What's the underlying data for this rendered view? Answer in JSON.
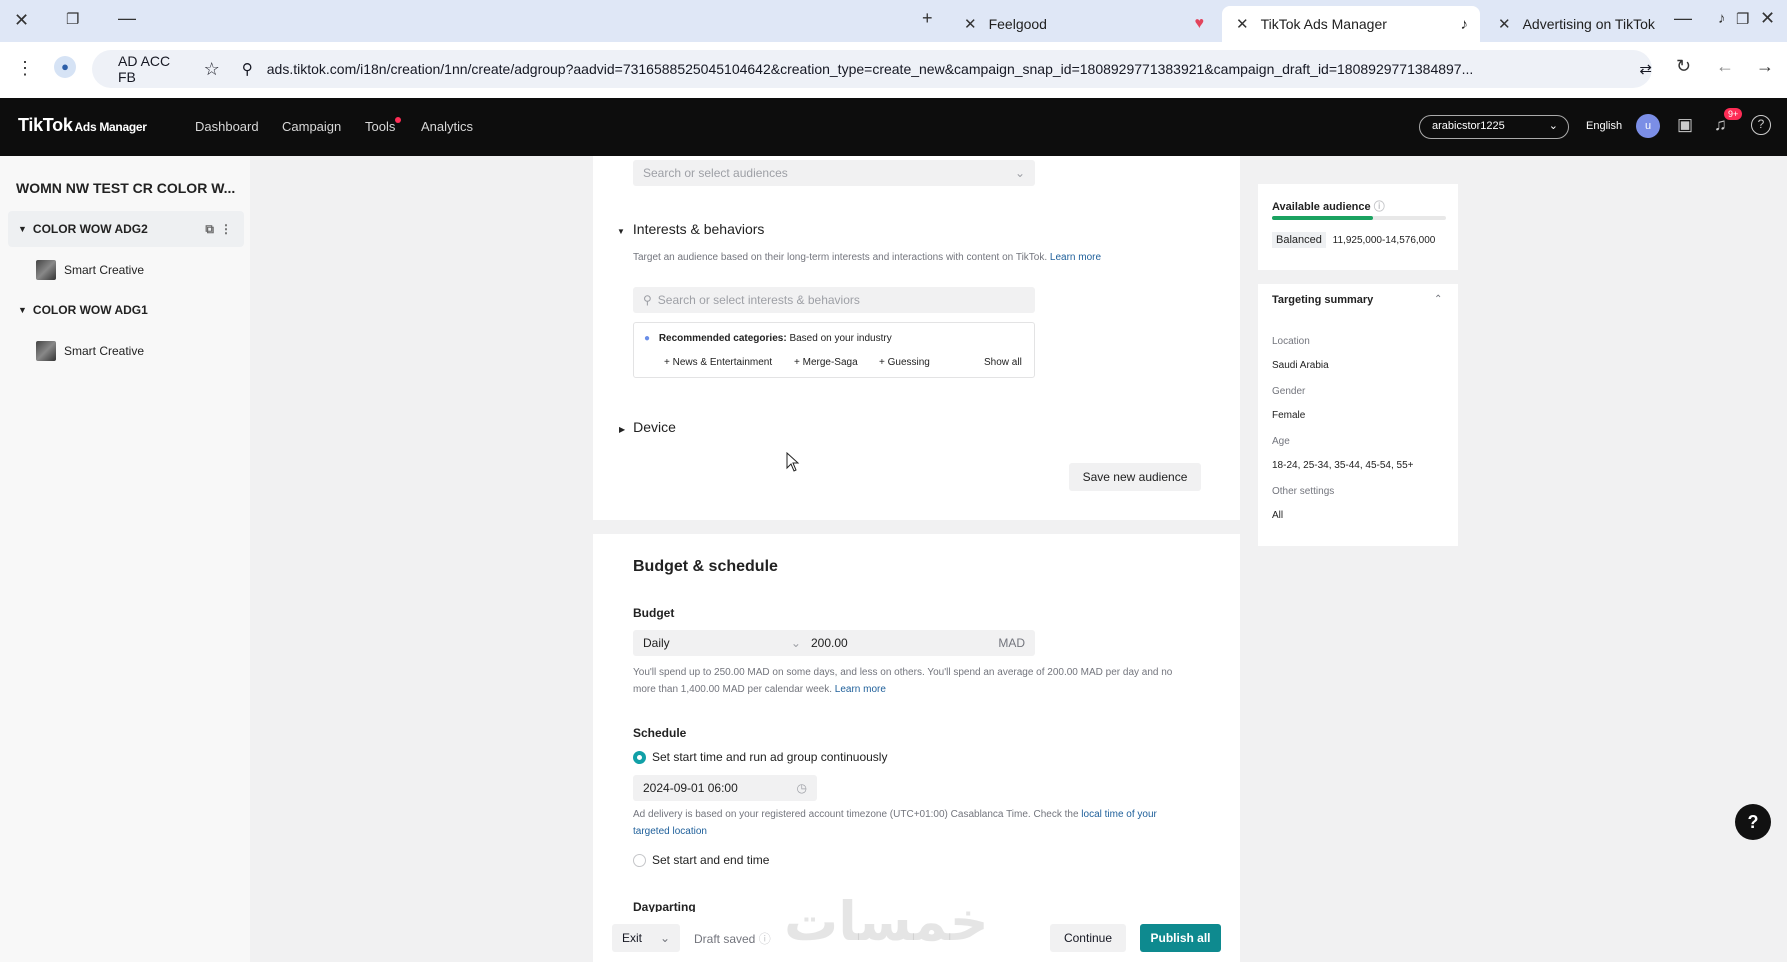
{
  "browser": {
    "tabs": [
      {
        "title": "Feelgood"
      },
      {
        "title": "TikTok Ads Manager"
      },
      {
        "title": "Advertising on TikTok"
      }
    ],
    "profile_label": "AD ACC FB",
    "url": "ads.tiktok.com/i18n/creation/1nn/create/adgroup?aadvid=7316588525045104642&creation_type=create_new&campaign_snap_id=1808929771383921&campaign_draft_id=1808929771384897..."
  },
  "header": {
    "logo": "TikTok",
    "logo_sub": "Ads Manager",
    "nav": [
      "Dashboard",
      "Campaign",
      "Tools",
      "Analytics"
    ],
    "account": "arabicstor1225",
    "language": "English",
    "avatar_letter": "u",
    "notif_badge": "9+"
  },
  "sidebar": {
    "campaign_title": "WOMN NW TEST CR COLOR W...",
    "groups": [
      {
        "label": "COLOR WOW ADG2",
        "child": "Smart Creative"
      },
      {
        "label": "COLOR WOW ADG1",
        "child": "Smart Creative"
      }
    ]
  },
  "audience": {
    "search_placeholder": "Search or select audiences",
    "interests_heading": "Interests & behaviors",
    "interests_desc": "Target an audience based on their long-term interests and interactions with content on TikTok.",
    "learn_more": "Learn more",
    "interests_placeholder": "Search or select interests & behaviors",
    "recommended_label": "Recommended categories:",
    "recommended_sub": "Based on your industry",
    "categories": [
      "+ News & Entertainment",
      "+ Merge-Saga",
      "+ Guessing"
    ],
    "show_all": "Show all",
    "device_heading": "Device",
    "save_button": "Save new audience"
  },
  "budget": {
    "heading": "Budget & schedule",
    "budget_label": "Budget",
    "budget_type": "Daily",
    "amount": "200.00",
    "currency": "MAD",
    "note_line1": "You'll spend up to 250.00 MAD on some days, and less on others. You'll spend an average of 200.00 MAD per day and no",
    "note_line2": "more than 1,400.00 MAD per calendar week.",
    "learn_more": "Learn more",
    "schedule_label": "Schedule",
    "option_continuous": "Set start time and run ad group continuously",
    "start_time": "2024-09-01 06:00",
    "tz_note_line1": "Ad delivery is based on your registered account timezone (UTC+01:00) Casablanca Time. Check the",
    "tz_link_line1": "local time of your",
    "tz_link_line2": "targeted location",
    "option_start_end": "Set start and end time",
    "dayparting_label": "Dayparting"
  },
  "right_panel": {
    "available_title": "Available audience",
    "available_level": 0.58,
    "balanced_tag": "Balanced",
    "audience_range": "11,925,000-14,576,000",
    "summary_title": "Targeting summary",
    "summary": [
      {
        "key": "Location",
        "value": "Saudi Arabia"
      },
      {
        "key": "Gender",
        "value": "Female"
      },
      {
        "key": "Age",
        "value": "18-24, 25-34, 35-44, 45-54, 55+"
      },
      {
        "key": "Other settings",
        "value": "All"
      }
    ]
  },
  "footer": {
    "exit": "Exit",
    "draft_saved": "Draft saved",
    "continue": "Continue",
    "publish": "Publish all"
  },
  "watermark": "خمسات",
  "colors": {
    "accent": "#11a0a7",
    "publish": "#0e8a8f",
    "progress": "#1aa260",
    "header_bg": "#0d0d0d",
    "tab_bar": "#dfe7f6"
  }
}
